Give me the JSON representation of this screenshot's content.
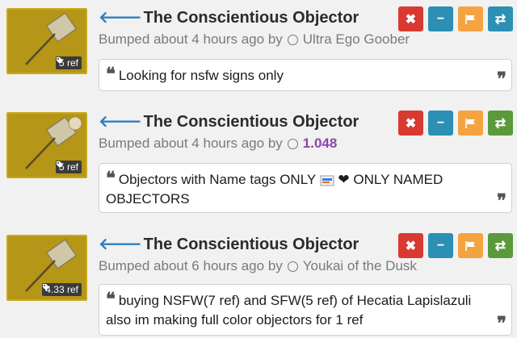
{
  "listings": [
    {
      "title": "The Conscientious Objector",
      "bumped_prefix": "Bumped about 4 hours ago by",
      "username": "Ultra Ego Goober",
      "ref_badge": "5 ref",
      "note": "Looking for nsfw signs only",
      "note_line2": "",
      "username_color": "#7a7a7a"
    },
    {
      "title": "The Conscientious Objector",
      "bumped_prefix": "Bumped about 4 hours ago by",
      "username": "1.048",
      "ref_badge": "5 ref",
      "note": "Objectors with Name tags ONLY",
      "note_after_emoji": "ONLY NAMED",
      "note_line2": "OBJECTORS",
      "username_color": "#8e44ad"
    },
    {
      "title": "The Conscientious Objector",
      "bumped_prefix": "Bumped about 6 hours ago by",
      "username": "Youkai of the Dusk",
      "ref_badge": "4.33 ref",
      "note": "buying NSFW(7 ref) and SFW(5 ref) of Hecatia Lapislazuli",
      "note_line2": "also im making full color objectors for 1 ref",
      "username_color": "#7a7a7a"
    }
  ],
  "icons": {
    "back": "left-arrow-icon",
    "user": "user-circle-icon",
    "remove": "x-icon",
    "minus": "minus-icon",
    "flag": "flag-icon",
    "swap": "swap-arrows-icon",
    "quote_open": "open-quote-icon",
    "quote_close": "close-quote-icon",
    "tag": "tag-icon"
  },
  "colors": {
    "back_arrow": "#2d7fc1",
    "btn_red": "#d83a32",
    "btn_blue": "#2c8fb4",
    "btn_orange": "#f4a341",
    "btn_green": "#5b9a3b",
    "thumb_bg": "#b59616"
  }
}
